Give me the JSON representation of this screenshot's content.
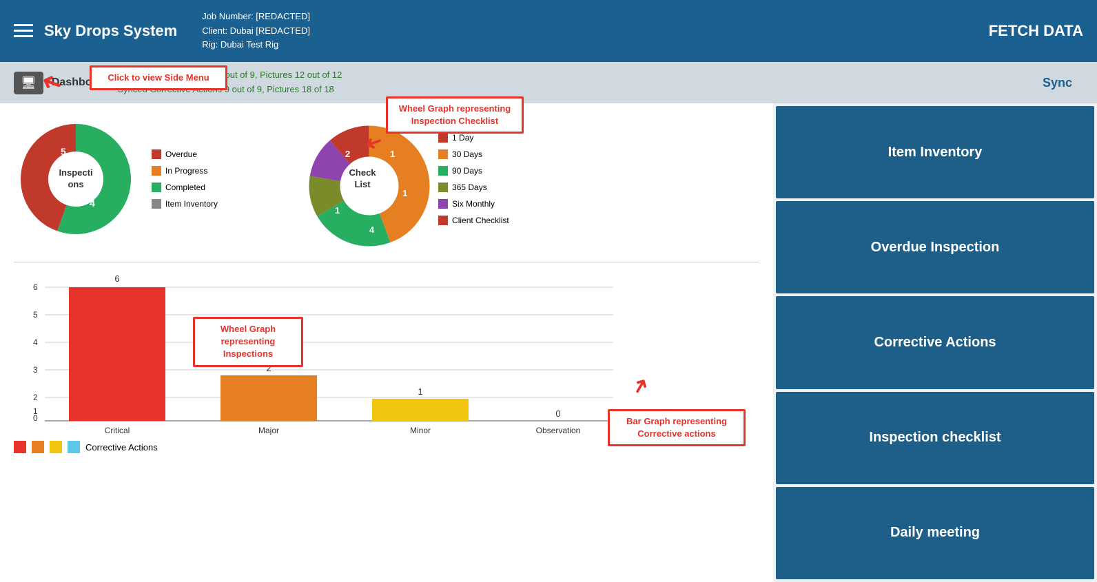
{
  "header": {
    "title": "Sky Drops System",
    "job_number": "Job Number: [REDACTED]",
    "client": "Client: Dubai [REDACTED]",
    "rig": "Rig: Dubai Test Rig",
    "fetch_btn": "FETCH DATA"
  },
  "statusbar": {
    "dashboard_label": "Dashboard",
    "status_line1": "Synced Inspection Items 9 out of 9, Pictures 12 out of 12",
    "status_line2": "Synced Corrective Actions 9 out of 9, Pictures 18 of 18",
    "sync_btn": "Sync"
  },
  "inspections_chart": {
    "title": "Inspections",
    "segments": [
      {
        "label": "Overdue",
        "color": "#c0392b",
        "value": 4
      },
      {
        "label": "In Progress",
        "color": "#e67e22",
        "value": 0
      },
      {
        "label": "Completed",
        "color": "#27ae60",
        "value": 5
      },
      {
        "label": "Item Inventory",
        "color": "#888",
        "value": 0
      }
    ]
  },
  "checklist_chart": {
    "title": "Check List",
    "segments": [
      {
        "label": "1 Day",
        "color": "#c0392b",
        "value": 1
      },
      {
        "label": "30 Days",
        "color": "#e67e22",
        "value": 4
      },
      {
        "label": "90 Days",
        "color": "#27ae60",
        "value": 2
      },
      {
        "label": "365 Days",
        "color": "#7a8c2a",
        "value": 1
      },
      {
        "label": "Six Monthly",
        "color": "#8e44ad",
        "value": 1
      },
      {
        "label": "Client Checklist",
        "color": "#c0392b",
        "value": 0
      }
    ]
  },
  "bar_chart": {
    "bars": [
      {
        "label": "Critical",
        "value": 6,
        "color": "#e8332a"
      },
      {
        "label": "Major",
        "value": 2,
        "color": "#e67e22"
      },
      {
        "label": "Minor",
        "value": 1,
        "color": "#f1c40f"
      },
      {
        "label": "Observation",
        "value": 0,
        "color": "#5bc8e8"
      }
    ],
    "legend_label": "Corrective Actions",
    "y_max": 6
  },
  "annotations": {
    "side_menu": "Click to view Side Menu",
    "wheel_inspections": "Wheel Graph\nrepresenting\nInspections",
    "wheel_checklist": "Wheel Graph representing\nInspection Checklist",
    "bar_corrective": "Bar Graph representing\nCorrective actions"
  },
  "sidebar": {
    "buttons": [
      "Item Inventory",
      "Overdue Inspection",
      "Corrective Actions",
      "Inspection checklist",
      "Daily meeting"
    ]
  }
}
